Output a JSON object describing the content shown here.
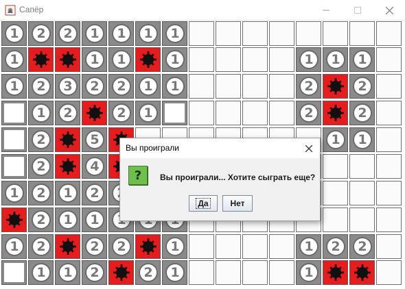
{
  "window": {
    "title": "Сапёр",
    "controls": [
      "minimize-icon",
      "maximize-icon",
      "close-icon"
    ]
  },
  "board": {
    "rows": 10,
    "cols": 15,
    "cells": [
      [
        "1",
        "2",
        "2",
        "1",
        "1",
        "1",
        "1",
        ".",
        ".",
        ".",
        ".",
        ".",
        ".",
        ".",
        "."
      ],
      [
        "1",
        "*",
        "*",
        "1",
        "1",
        "*",
        "1",
        ".",
        ".",
        ".",
        ".",
        "1",
        "1",
        "1",
        "."
      ],
      [
        "1",
        "2",
        "3",
        "2",
        "2",
        "1",
        "1",
        ".",
        ".",
        ".",
        ".",
        "2",
        "*",
        "2",
        "."
      ],
      [
        "0",
        "1",
        "2",
        "*",
        "2",
        "1",
        "0",
        ".",
        ".",
        ".",
        ".",
        "2",
        "*",
        "2",
        "."
      ],
      [
        "0",
        "2",
        "*",
        "5",
        "*",
        ".",
        ".",
        ".",
        ".",
        ".",
        ".",
        ".",
        "1",
        "1",
        "."
      ],
      [
        "0",
        "2",
        "*",
        "4",
        "*",
        ".",
        ".",
        ".",
        ".",
        ".",
        ".",
        ".",
        ".",
        ".",
        "."
      ],
      [
        "1",
        "2",
        "1",
        "2",
        "2",
        ".",
        ".",
        ".",
        ".",
        ".",
        ".",
        ".",
        ".",
        ".",
        "."
      ],
      [
        "*",
        "2",
        "1",
        "1",
        "1",
        "1",
        "1",
        ".",
        ".",
        ".",
        ".",
        ".",
        ".",
        ".",
        "."
      ],
      [
        "1",
        "2",
        "*",
        "2",
        "2",
        "*",
        "1",
        ".",
        ".",
        ".",
        ".",
        "1",
        "2",
        "2",
        "."
      ],
      [
        "0",
        "1",
        "1",
        "2",
        "*",
        "2",
        "1",
        ".",
        ".",
        ".",
        ".",
        "1",
        "*",
        "*",
        "."
      ]
    ],
    "colors": {
      "mine_background": "#e71c1c",
      "revealed_frame": "#8a8a8a",
      "number_text": "#777777",
      "closed_cell": "#fbfbfb"
    }
  },
  "dialog": {
    "title": "Вы проиграли",
    "icon": "question-icon",
    "message": "Вы проиграли... Хотите сыграть еще?",
    "yes_label": "Да",
    "no_label": "Нет"
  }
}
